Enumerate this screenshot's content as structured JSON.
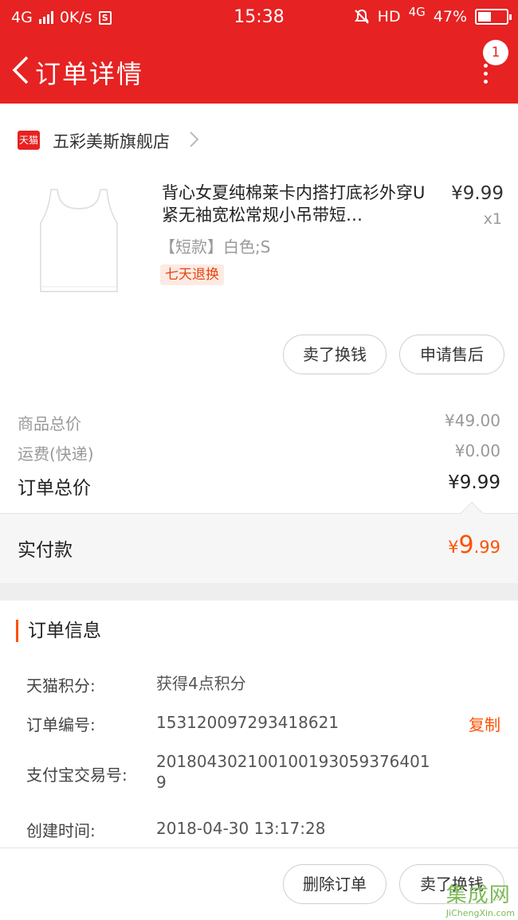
{
  "status_bar": {
    "network": "4G",
    "speed": "0K/s",
    "time": "15:38",
    "hd": "HD",
    "network_right": "4G",
    "battery": "47%",
    "battery_level": 0.47
  },
  "header": {
    "title": "订单详情",
    "badge": "1"
  },
  "store": {
    "badge_text": "天猫",
    "name": "五彩美斯旗舰店"
  },
  "product": {
    "title": "背心女夏纯棉莱卡内搭打底衫外穿U紧无袖宽松常规小吊带短…",
    "price": "¥9.99",
    "quantity": "x1",
    "sku": "【短款】白色;S",
    "tag": "七天退换",
    "sell_label": "卖了换钱",
    "after_sale_label": "申请售后"
  },
  "prices": {
    "goods_label": "商品总价",
    "goods_value": "¥49.00",
    "shipping_label": "运费(快递)",
    "shipping_value": "¥0.00",
    "order_total_label": "订单总价",
    "order_total_value": "¥9.99",
    "paid_label": "实付款",
    "paid_currency": "¥",
    "paid_int": "9",
    "paid_dec": ".99"
  },
  "order_info": {
    "title": "订单信息",
    "points_label": "天猫积分:",
    "points_value": "获得4点积分",
    "order_no_label": "订单编号:",
    "order_no_value": "153120097293418621",
    "copy_label": "复制",
    "alipay_label": "支付宝交易号:",
    "alipay_value": "2018043021001001930593764019",
    "created_label": "创建时间:",
    "created_value": "2018-04-30 13:17:28"
  },
  "bottom": {
    "delete_label": "删除订单",
    "sell_label": "卖了换钱"
  },
  "watermark": {
    "text": "集成网",
    "url": "JiChengXin.com"
  },
  "colors": {
    "brand_red": "#e62222",
    "accent_orange": "#ff5000"
  }
}
